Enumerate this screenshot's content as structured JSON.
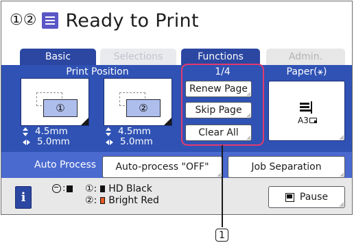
{
  "header": {
    "drum_numbers": "①②",
    "title": "Ready to Print",
    "status_icon": "document-icon"
  },
  "tabs": [
    {
      "label": "Basic",
      "active": true
    },
    {
      "label": "Selections",
      "active": false
    },
    {
      "label": "Functions",
      "active": true
    },
    {
      "label": "Admin.",
      "active": false
    }
  ],
  "print_position": {
    "header": "Print Position",
    "drum1": {
      "label": "①",
      "vertical": "4.5mm",
      "horizontal": "5.0mm"
    },
    "drum2": {
      "label": "②",
      "vertical": "4.5mm",
      "horizontal": "5.0mm"
    }
  },
  "functions": {
    "page_indicator": "1/4",
    "buttons": [
      "Renew Page",
      "Skip Page",
      "Clear All"
    ]
  },
  "paper": {
    "header": "Paper(⚹)",
    "size": "A3"
  },
  "auto_process": {
    "label": "Auto Process",
    "auto_button": "Auto-process \"OFF\"",
    "job_button": "Job Separation"
  },
  "status": {
    "master_label": ":",
    "drum1": {
      "label": "①:",
      "ink": "HD Black",
      "color": "#111111"
    },
    "drum2": {
      "label": "②:",
      "ink": "Bright Red",
      "color": "#e65a24"
    },
    "pause_label": "Pause"
  },
  "callout": {
    "number": "1"
  },
  "colors": {
    "accent": "#2b47a1",
    "panel": "#2f52b4",
    "highlight": "#e53a6e"
  }
}
